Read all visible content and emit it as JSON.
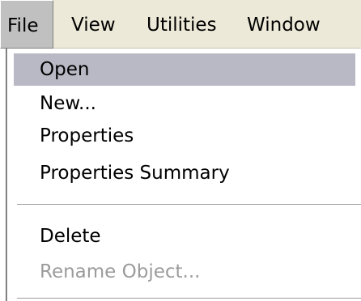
{
  "menubar": {
    "items": [
      {
        "label": "File"
      },
      {
        "label": "View"
      },
      {
        "label": "Utilities"
      },
      {
        "label": "Window"
      }
    ],
    "active": "File"
  },
  "file_menu": {
    "items": [
      {
        "label": "Open",
        "state": "highlighted"
      },
      {
        "label": "New...",
        "state": "enabled"
      },
      {
        "label": "Properties",
        "state": "enabled"
      },
      {
        "label": "Properties Summary",
        "state": "enabled"
      },
      {
        "label": "Delete",
        "state": "enabled"
      },
      {
        "label": "Rename Object...",
        "state": "disabled"
      }
    ]
  },
  "colors": {
    "menubar_bg": "#ece9d8",
    "highlight_bg": "#b9b9c5",
    "disabled_text": "#9b9b9b",
    "separator": "#9d9d9d"
  }
}
